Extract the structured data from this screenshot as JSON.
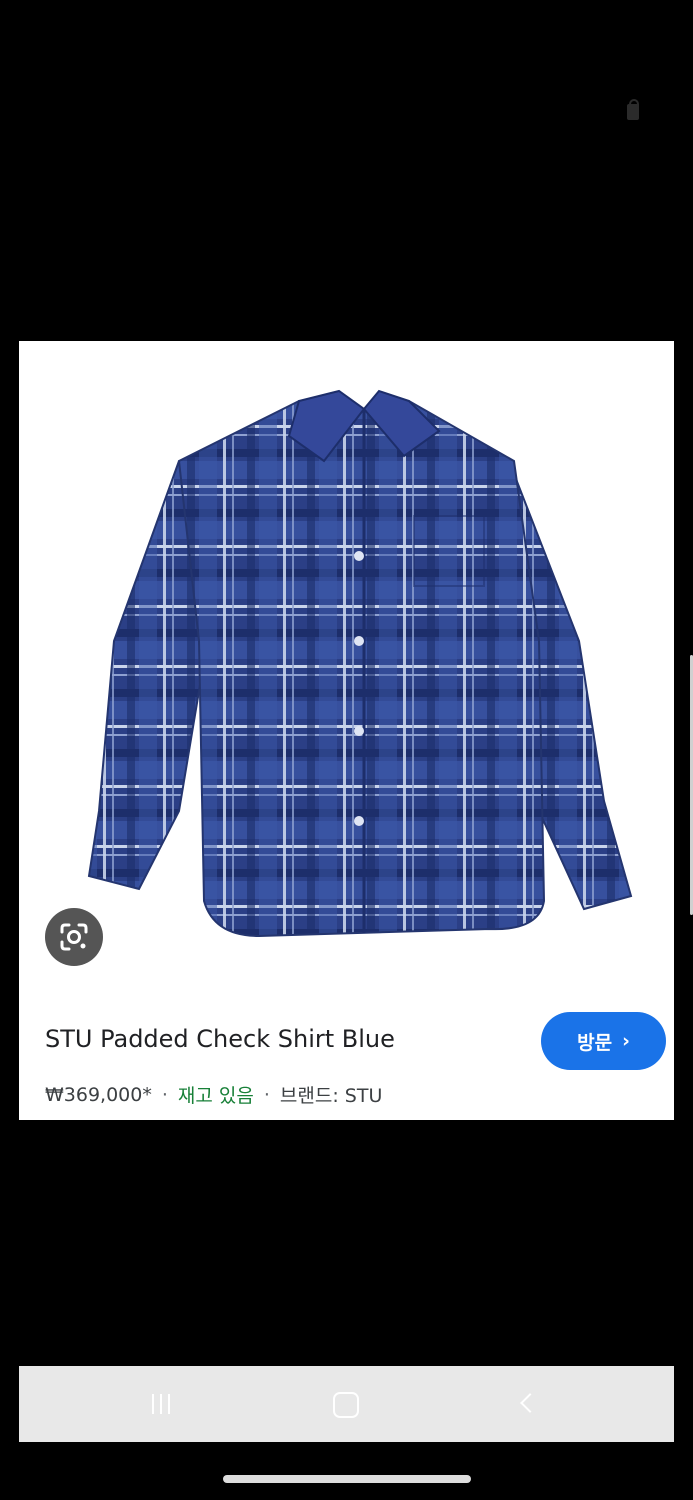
{
  "product": {
    "title": "STU Padded Check Shirt Blue",
    "price": "₩369,000*",
    "separator": "·",
    "stock": "재고 있음",
    "brand": "브랜드: STU",
    "visit_label": "방문",
    "visit_chevron": "›",
    "image_icon": "plaid-shirt-image",
    "lens_icon": "google-lens-icon",
    "colors": {
      "visit_button": "#1a73e8",
      "stock_text": "#188038"
    }
  },
  "nav": {
    "recent_icon": "recent-apps-icon",
    "home_icon": "home-icon",
    "back_icon": "back-icon"
  }
}
